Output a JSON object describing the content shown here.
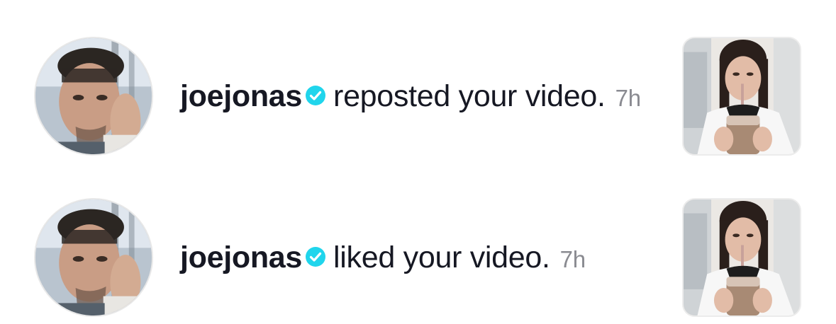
{
  "notifications": [
    {
      "username": "joejonas",
      "verified": true,
      "action": "reposted your video.",
      "time": "7h",
      "avatar_icon": "user-avatar-photo",
      "thumbnail_icon": "video-thumbnail"
    },
    {
      "username": "joejonas",
      "verified": true,
      "action": "liked your video.",
      "time": "7h",
      "avatar_icon": "user-avatar-photo",
      "thumbnail_icon": "video-thumbnail"
    }
  ],
  "colors": {
    "text": "#161823",
    "timestamp": "#8a8b91",
    "verified_badge": "#20d5ec",
    "background": "#ffffff"
  }
}
